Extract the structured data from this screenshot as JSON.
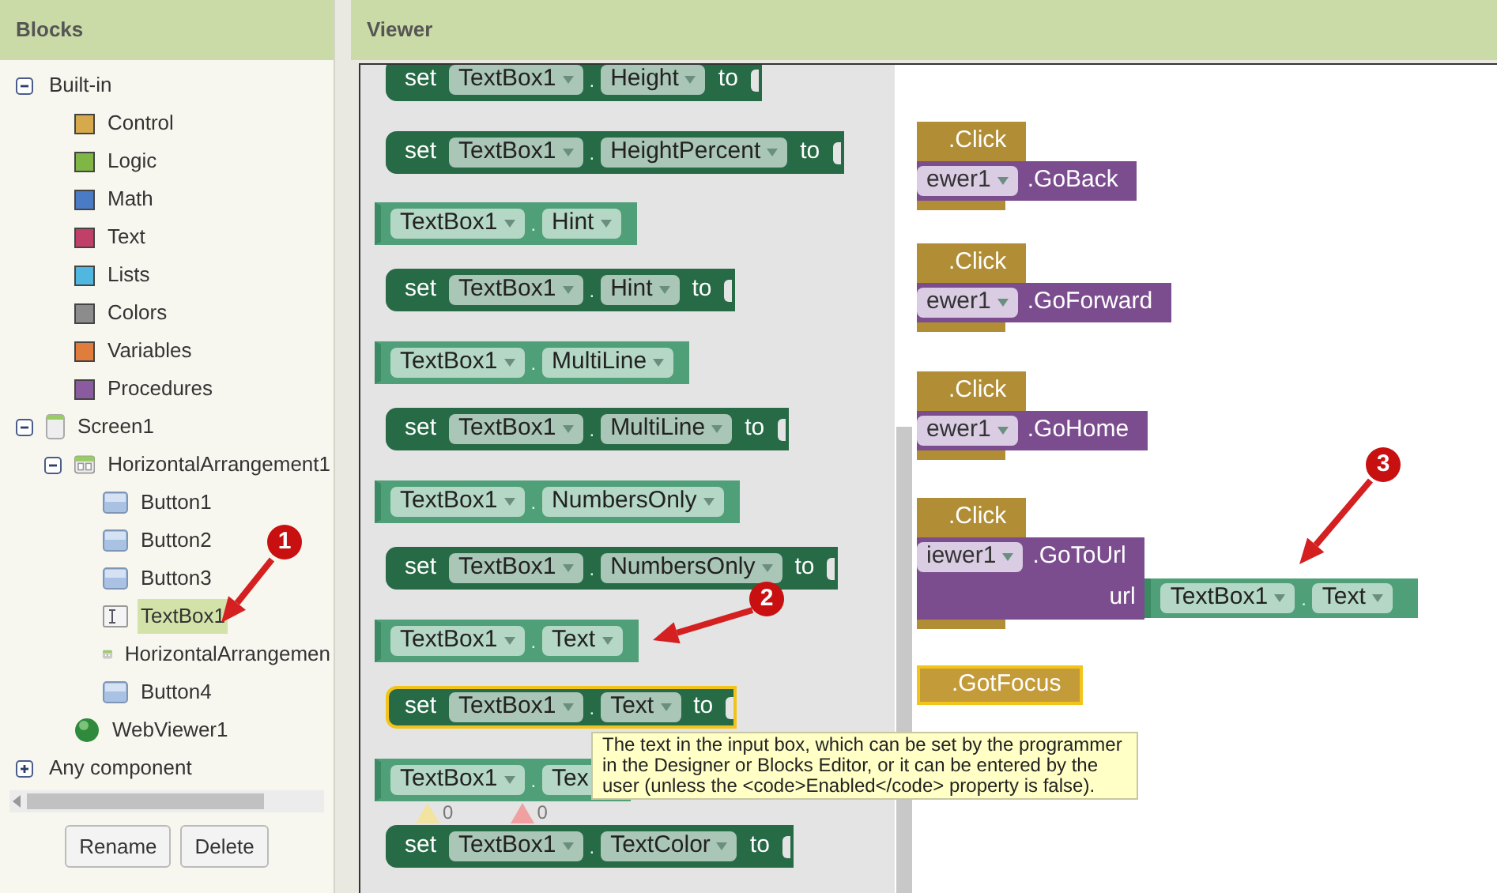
{
  "sidebar": {
    "title": "Blocks",
    "buttons": [
      "Rename",
      "Delete"
    ]
  },
  "tree": [
    {
      "label": "Built-in",
      "kind": "folder",
      "expanded": true,
      "selected": false,
      "children": [
        {
          "label": "Control",
          "kind": "category",
          "color": "#d6aa4c",
          "selected": false
        },
        {
          "label": "Logic",
          "kind": "category",
          "color": "#7fb646",
          "selected": false
        },
        {
          "label": "Math",
          "kind": "category",
          "color": "#4a7bc5",
          "selected": false
        },
        {
          "label": "Text",
          "kind": "category",
          "color": "#c1406a",
          "selected": false
        },
        {
          "label": "Lists",
          "kind": "category",
          "color": "#4fb7e0",
          "selected": false
        },
        {
          "label": "Colors",
          "kind": "category",
          "color": "#8c8c8c",
          "selected": false
        },
        {
          "label": "Variables",
          "kind": "category",
          "color": "#e07c3c",
          "selected": false
        },
        {
          "label": "Procedures",
          "kind": "category",
          "color": "#8a5b9f",
          "selected": false
        }
      ]
    },
    {
      "label": "Screen1",
      "kind": "screen",
      "expanded": true,
      "selected": false,
      "children": [
        {
          "label": "HorizontalArrangement1",
          "kind": "arrangement",
          "expanded": true,
          "selected": false,
          "children": [
            {
              "label": "Button1",
              "kind": "button",
              "selected": false
            },
            {
              "label": "Button2",
              "kind": "button",
              "selected": false
            },
            {
              "label": "Button3",
              "kind": "button",
              "selected": false
            },
            {
              "label": "TextBox1",
              "kind": "textbox",
              "selected": true
            },
            {
              "label": "HorizontalArrangemen",
              "kind": "arrangement",
              "selected": false
            },
            {
              "label": "Button4",
              "kind": "button",
              "selected": false
            }
          ]
        },
        {
          "label": "WebViewer1",
          "kind": "webviewer",
          "selected": false
        }
      ]
    },
    {
      "label": "Any component",
      "kind": "folder",
      "expanded": false,
      "selected": false
    }
  ],
  "viewer": {
    "title": "Viewer"
  },
  "flyout": [
    {
      "kind": "setter",
      "set": "set",
      "component": "TextBox1",
      "separator": ".",
      "property": "Height",
      "to": "to",
      "selected": false
    },
    {
      "kind": "setter",
      "set": "set",
      "component": "TextBox1",
      "separator": ".",
      "property": "HeightPercent",
      "to": "to",
      "selected": false
    },
    {
      "kind": "getter",
      "component": "TextBox1",
      "separator": ".",
      "property": "Hint",
      "selected": false
    },
    {
      "kind": "setter",
      "set": "set",
      "component": "TextBox1",
      "separator": ".",
      "property": "Hint",
      "to": "to",
      "selected": false
    },
    {
      "kind": "getter",
      "component": "TextBox1",
      "separator": ".",
      "property": "MultiLine",
      "selected": false
    },
    {
      "kind": "setter",
      "set": "set",
      "component": "TextBox1",
      "separator": ".",
      "property": "MultiLine",
      "to": "to",
      "selected": false
    },
    {
      "kind": "getter",
      "component": "TextBox1",
      "separator": ".",
      "property": "NumbersOnly",
      "selected": false
    },
    {
      "kind": "setter",
      "set": "set",
      "component": "TextBox1",
      "separator": ".",
      "property": "NumbersOnly",
      "to": "to",
      "selected": false
    },
    {
      "kind": "getter",
      "component": "TextBox1",
      "separator": ".",
      "property": "Text",
      "selected": false
    },
    {
      "kind": "setter",
      "set": "set",
      "component": "TextBox1",
      "separator": ".",
      "property": "Text",
      "to": "to",
      "selected": true
    },
    {
      "kind": "getter",
      "component": "TextBox1",
      "separator": ".",
      "property": "Tex",
      "selected": false
    },
    {
      "kind": "setter",
      "set": "set",
      "component": "TextBox1",
      "separator": ".",
      "property": "TextColor",
      "to": "to",
      "selected": false
    }
  ],
  "workspace": [
    {
      "event": ".Click",
      "selected": false,
      "call": {
        "component": "ewer1",
        "method": ".GoBack"
      }
    },
    {
      "event": ".Click",
      "selected": false,
      "call": {
        "component": "ewer1",
        "method": ".GoForward"
      }
    },
    {
      "event": ".Click",
      "selected": false,
      "call": {
        "component": "ewer1",
        "method": ".GoHome"
      }
    },
    {
      "event": ".Click",
      "selected": false,
      "call": {
        "component": "iewer1",
        "method": ".GoToUrl",
        "arg_label": "url",
        "arg": {
          "component": "TextBox1",
          "separator": ".",
          "property": "Text"
        }
      }
    },
    {
      "event": ".GotFocus",
      "selected": true
    }
  ],
  "diagnostics": {
    "warnings": "0",
    "errors": "0"
  },
  "tooltip": "The text in the input box, which can be set by the programmer in the Designer or Blocks Editor, or it can be entered by the user (unless the <code>Enabled</code> property is false).",
  "annotations": [
    {
      "number": "1"
    },
    {
      "number": "2"
    },
    {
      "number": "3"
    }
  ]
}
